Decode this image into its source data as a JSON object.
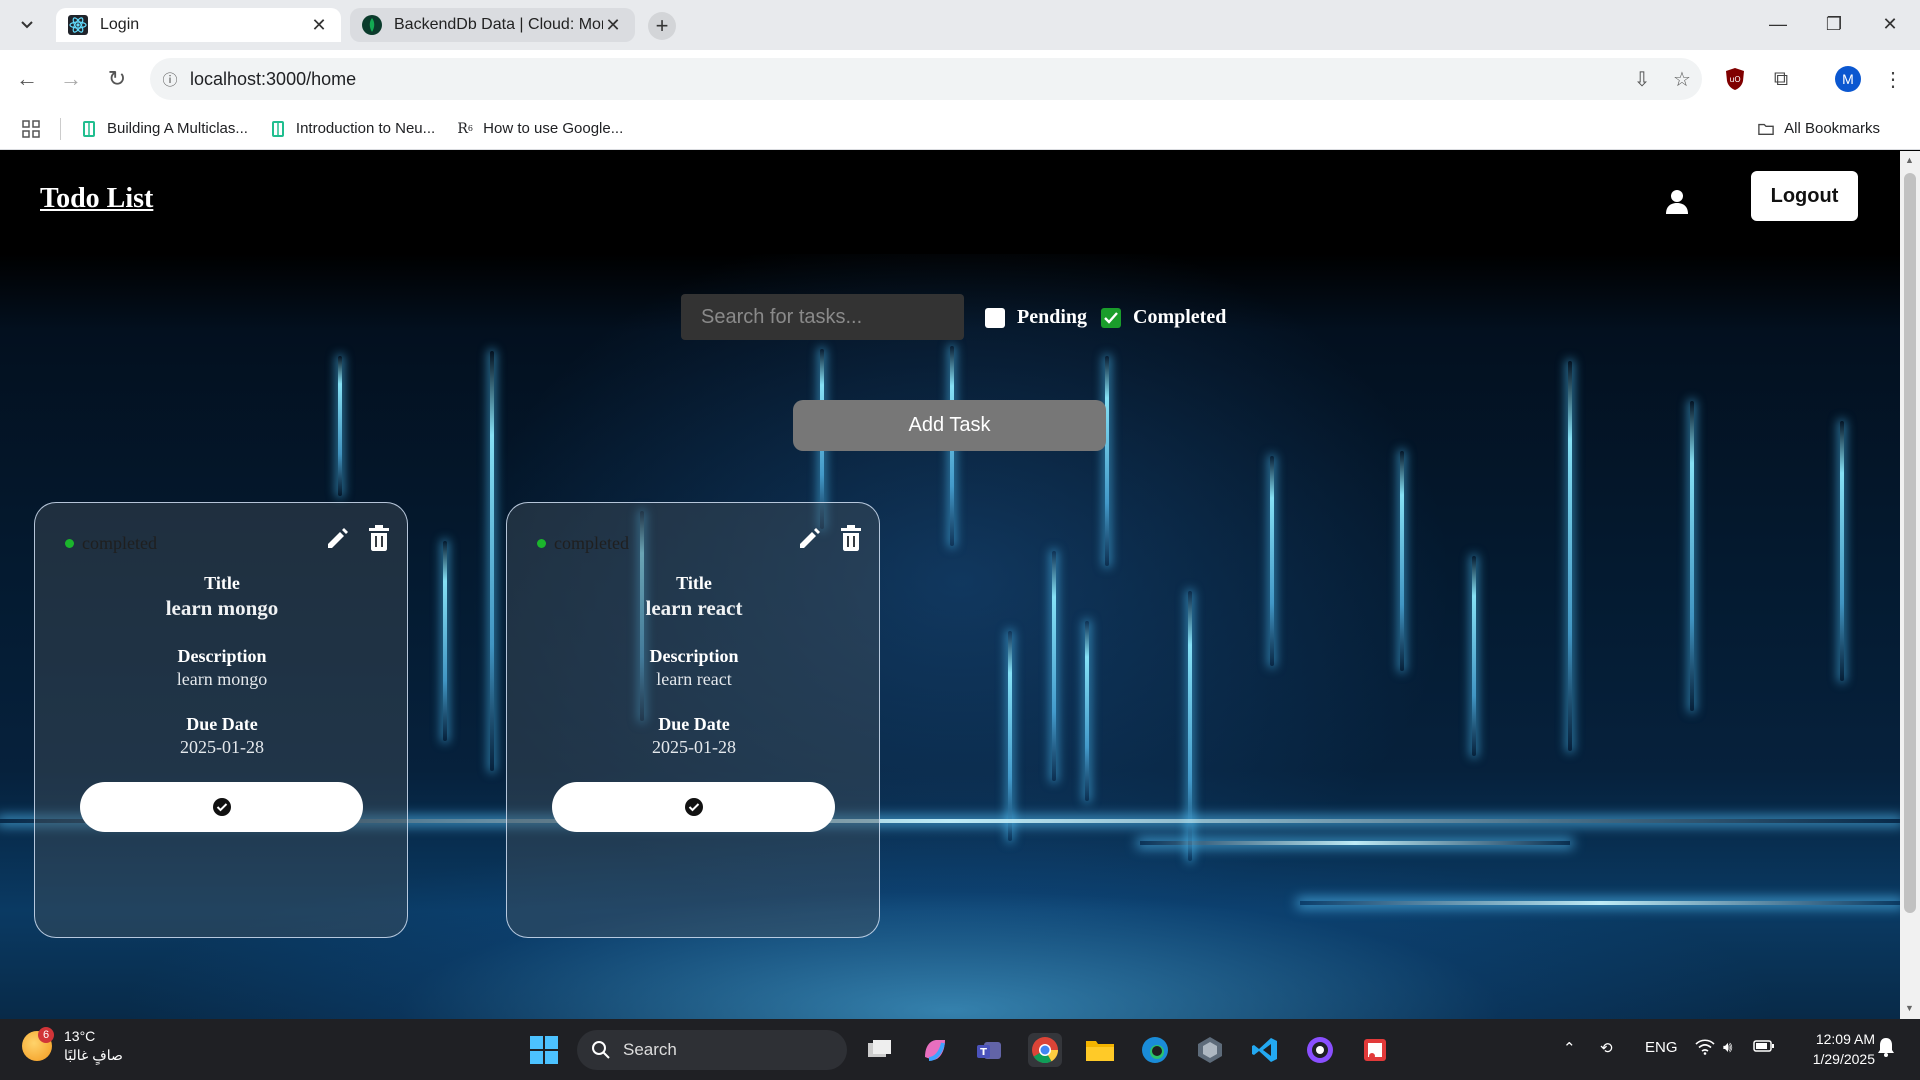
{
  "browser": {
    "tabs": [
      {
        "title": "Login",
        "active": true
      },
      {
        "title": "BackendDb Data | Cloud: Mong",
        "active": false
      }
    ],
    "url": "localhost:3000/home",
    "profile_initial": "M",
    "bookmarks": [
      {
        "label": "Building A Multiclas..."
      },
      {
        "label": "Introduction to Neu..."
      },
      {
        "label": "How to use Google..."
      }
    ],
    "all_bookmarks_label": "All Bookmarks"
  },
  "app": {
    "brand": "Todo List",
    "logout_label": "Logout",
    "search_placeholder": "Search for tasks...",
    "filters": [
      {
        "label": "Pending",
        "checked": false
      },
      {
        "label": "Completed",
        "checked": true
      }
    ],
    "add_task_label": "Add Task",
    "field_labels": {
      "title": "Title",
      "description": "Description",
      "due_date": "Due Date"
    },
    "tasks": [
      {
        "status": "completed",
        "title": "learn mongo",
        "description": "learn mongo",
        "due_date": "2025-01-28"
      },
      {
        "status": "completed",
        "title": "learn react",
        "description": "learn react",
        "due_date": "2025-01-28"
      }
    ]
  },
  "taskbar": {
    "weather_temp": "13°C",
    "weather_desc": "صافٍ غالبًا",
    "weather_badge": "6",
    "search_label": "Search",
    "language": "ENG",
    "time": "12:09 AM",
    "date": "1/29/2025"
  },
  "colors": {
    "status_dot": "#1bb52c",
    "checkbox_checked": "#1a9d2b",
    "add_task_bg": "#777777",
    "taskbar_bg": "#1f2024"
  }
}
